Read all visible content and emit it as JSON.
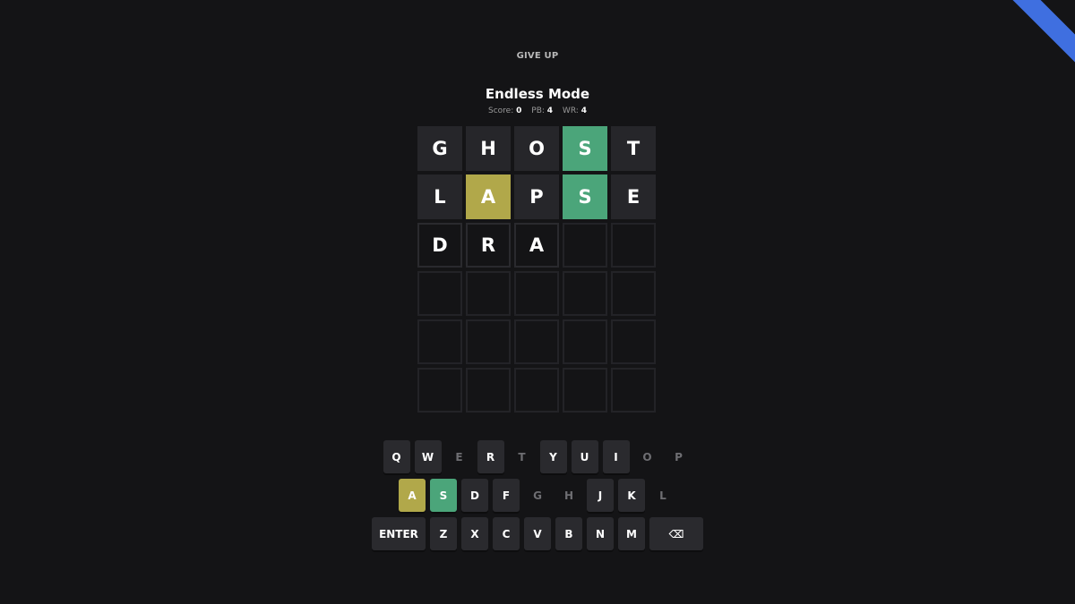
{
  "header": {
    "give_up": "GIVE UP",
    "title": "Endless Mode",
    "score_label": "Score:",
    "score_value": "0",
    "pb_label": "PB:",
    "pb_value": "4",
    "wr_label": "WR:",
    "wr_value": "4"
  },
  "board": {
    "rows": [
      [
        {
          "l": "G",
          "s": "absent"
        },
        {
          "l": "H",
          "s": "absent"
        },
        {
          "l": "O",
          "s": "absent"
        },
        {
          "l": "S",
          "s": "correct"
        },
        {
          "l": "T",
          "s": "absent"
        }
      ],
      [
        {
          "l": "L",
          "s": "absent"
        },
        {
          "l": "A",
          "s": "present"
        },
        {
          "l": "P",
          "s": "absent"
        },
        {
          "l": "S",
          "s": "correct"
        },
        {
          "l": "E",
          "s": "absent"
        }
      ],
      [
        {
          "l": "D",
          "s": "typed"
        },
        {
          "l": "R",
          "s": "typed"
        },
        {
          "l": "A",
          "s": "typed"
        },
        {
          "l": "",
          "s": "empty"
        },
        {
          "l": "",
          "s": "empty"
        }
      ],
      [
        {
          "l": "",
          "s": "empty"
        },
        {
          "l": "",
          "s": "empty"
        },
        {
          "l": "",
          "s": "empty"
        },
        {
          "l": "",
          "s": "empty"
        },
        {
          "l": "",
          "s": "empty"
        }
      ],
      [
        {
          "l": "",
          "s": "empty"
        },
        {
          "l": "",
          "s": "empty"
        },
        {
          "l": "",
          "s": "empty"
        },
        {
          "l": "",
          "s": "empty"
        },
        {
          "l": "",
          "s": "empty"
        }
      ],
      [
        {
          "l": "",
          "s": "empty"
        },
        {
          "l": "",
          "s": "empty"
        },
        {
          "l": "",
          "s": "empty"
        },
        {
          "l": "",
          "s": "empty"
        },
        {
          "l": "",
          "s": "empty"
        }
      ]
    ]
  },
  "keyboard": {
    "rows": [
      [
        {
          "k": "Q",
          "s": "unused"
        },
        {
          "k": "W",
          "s": "unused"
        },
        {
          "k": "E",
          "s": "used"
        },
        {
          "k": "R",
          "s": "unused"
        },
        {
          "k": "T",
          "s": "used"
        },
        {
          "k": "Y",
          "s": "unused"
        },
        {
          "k": "U",
          "s": "unused"
        },
        {
          "k": "I",
          "s": "unused"
        },
        {
          "k": "O",
          "s": "used"
        },
        {
          "k": "P",
          "s": "used"
        }
      ],
      [
        {
          "k": "A",
          "s": "present"
        },
        {
          "k": "S",
          "s": "correct"
        },
        {
          "k": "D",
          "s": "unused"
        },
        {
          "k": "F",
          "s": "unused"
        },
        {
          "k": "G",
          "s": "used"
        },
        {
          "k": "H",
          "s": "used"
        },
        {
          "k": "J",
          "s": "unused"
        },
        {
          "k": "K",
          "s": "unused"
        },
        {
          "k": "L",
          "s": "used"
        }
      ],
      [
        {
          "k": "ENTER",
          "s": "unused",
          "wide": true
        },
        {
          "k": "Z",
          "s": "unused"
        },
        {
          "k": "X",
          "s": "unused"
        },
        {
          "k": "C",
          "s": "unused"
        },
        {
          "k": "V",
          "s": "unused"
        },
        {
          "k": "B",
          "s": "unused"
        },
        {
          "k": "N",
          "s": "unused"
        },
        {
          "k": "M",
          "s": "unused"
        },
        {
          "k": "⌫",
          "s": "unused",
          "wide": true
        }
      ]
    ]
  },
  "colors": {
    "background": "#141416",
    "correct": "#4ba57a",
    "present": "#b1a84a",
    "absent": "#26262a",
    "ribbon": "#3f6fe0"
  },
  "icons": {
    "backspace": "backspace-icon"
  }
}
